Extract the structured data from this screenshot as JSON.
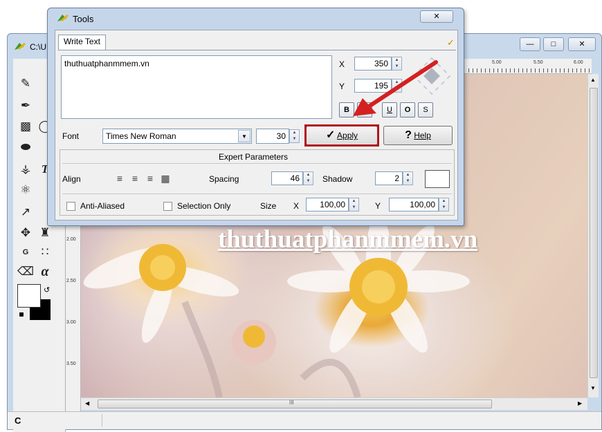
{
  "main_window": {
    "title": "C:\\U",
    "ruler_top": [
      "5.00",
      "5.50",
      "6.00"
    ],
    "ruler_left": [
      "2.00",
      "2.50",
      "3.00",
      "3.50"
    ],
    "canvas_text": "thuthuatphanmmem.vn",
    "status_text": "C",
    "hscroll_grip": "III"
  },
  "tools_dialog": {
    "title": "Tools",
    "close_label": "X",
    "tab_label": "Write Text",
    "text_value": "thuthuatphanmmem.vn",
    "x_label": "X",
    "x_value": "350",
    "y_label": "Y",
    "y_value": "195",
    "format_buttons": [
      "B",
      "I",
      "U",
      "O",
      "S"
    ],
    "font_label": "Font",
    "font_value": "Times New Roman",
    "font_size": "30",
    "apply_label": "Apply",
    "help_label": "Help",
    "expert_title": "Expert Parameters",
    "align_label": "Align",
    "spacing_label": "Spacing",
    "spacing_value": "46",
    "shadow_label": "Shadow",
    "shadow_value": "2",
    "antialias_label": "Anti-Aliased",
    "selection_only_label": "Selection Only",
    "size_label": "Size",
    "size_x_label": "X",
    "size_x_value": "100,00",
    "size_y_label": "Y",
    "size_y_value": "100,00"
  },
  "colors": {
    "dialog_frame": "#c5d6ea",
    "highlight_red": "#b0141b",
    "arrow_red": "#d42020"
  }
}
